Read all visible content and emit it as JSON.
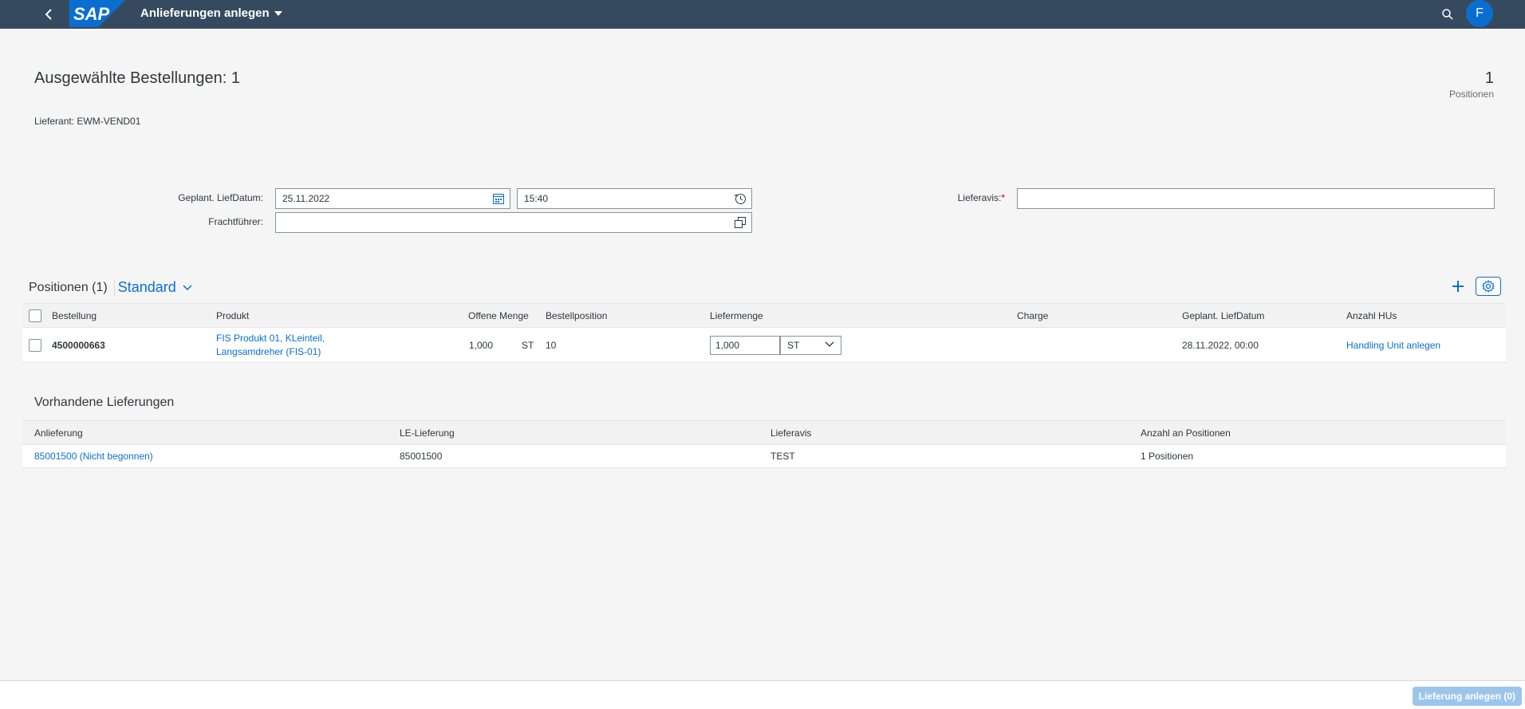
{
  "shell": {
    "app_title": "Anlieferungen anlegen",
    "logo_text": "SAP",
    "avatar_initial": "F"
  },
  "header": {
    "title": "Ausgewählte Bestellungen: 1",
    "count": "1",
    "count_label": "Positionen",
    "supplier": "Lieferant: EWM-VEND01"
  },
  "form": {
    "planned_date_label": "Geplant. LiefDatum:",
    "planned_date_value": "25.11.2022",
    "planned_time_value": "15:40",
    "carrier_label": "Frachtführer:",
    "carrier_value": "",
    "asn_label": "Lieferavis:",
    "asn_required": "*",
    "asn_value": ""
  },
  "positions": {
    "title": "Positionen (1)",
    "variant": "Standard",
    "columns": [
      "Bestellung",
      "Produkt",
      "Offene Menge",
      "Bestellposition",
      "Liefermenge",
      "Charge",
      "Geplant. LiefDatum",
      "Anzahl HUs"
    ],
    "rows": [
      {
        "order": "4500000663",
        "product_line1": "FIS Produkt 01, KLeinteil,",
        "product_line2": "Langsamdreher (FIS-01)",
        "open_qty": "1,000",
        "open_unit": "ST",
        "item": "10",
        "delivery_qty": "1,000",
        "delivery_unit": "ST",
        "batch": "",
        "planned_date": "28.11.2022, 00:00",
        "hu_action": "Handling Unit anlegen"
      }
    ]
  },
  "existing": {
    "title": "Vorhandene Lieferungen",
    "columns": [
      "Anlieferung",
      "LE-Lieferung",
      "Lieferavis",
      "Anzahl an Positionen"
    ],
    "rows": [
      {
        "inbound": "85001500 (Nicht begonnen)",
        "le_delivery": "85001500",
        "asn": "TEST",
        "positions": "1 Positionen"
      }
    ]
  },
  "footer": {
    "create_button": "Lieferung anlegen (0)"
  },
  "colors": {
    "shell": "#354a5f",
    "accent": "#0a6ed1",
    "background": "#f5f5f5"
  }
}
